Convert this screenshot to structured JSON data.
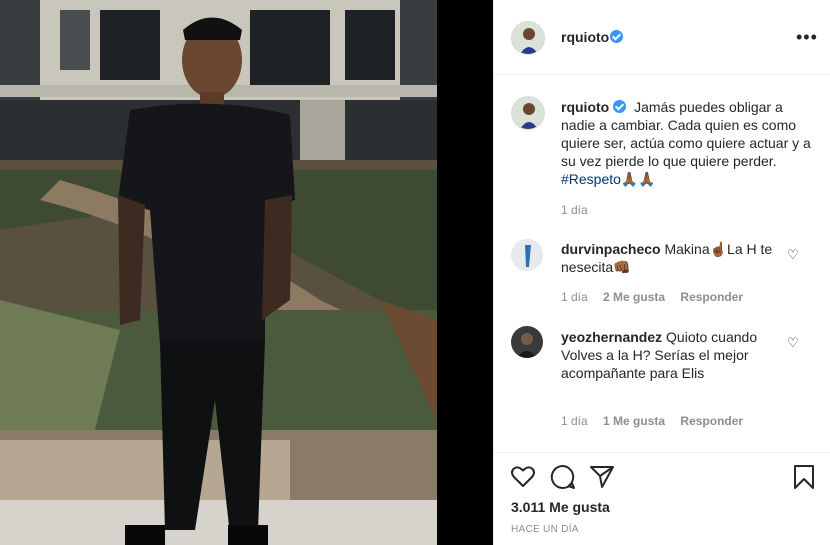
{
  "post": {
    "username": "rquioto",
    "caption_text": "Jamás puedes obligar a nadie a cambiar. Cada quien es como quiere ser, actúa como quiere actuar y a su vez pierde lo que quiere perder.",
    "hashtag": "#Respeto🙏🏾🙏🏾",
    "caption_time": "1 día",
    "likes": "3.011 Me gusta",
    "posted_ago": "HACE UN DÍA"
  },
  "comments": [
    {
      "username": "durvinpacheco",
      "text": "Makina☝🏾La H te nesecita👊🏾",
      "time": "1 día",
      "likes": "2 Me gusta",
      "reply": "Responder"
    },
    {
      "username": "yeozhernandez",
      "text": "Quioto cuando Volves a la H? Serías el mejor acompañante para Elis",
      "time": "1 día",
      "likes": "1 Me gusta",
      "reply": "Responder"
    }
  ],
  "icons": {
    "more": "more-options-icon",
    "like": "heart-icon",
    "comment": "comment-icon",
    "share": "share-icon",
    "save": "bookmark-icon",
    "verified": "verified-badge-icon"
  },
  "colors": {
    "verified": "#3897f0",
    "hashtag": "#00376b",
    "muted": "#8e8e8e",
    "text": "#262626"
  }
}
